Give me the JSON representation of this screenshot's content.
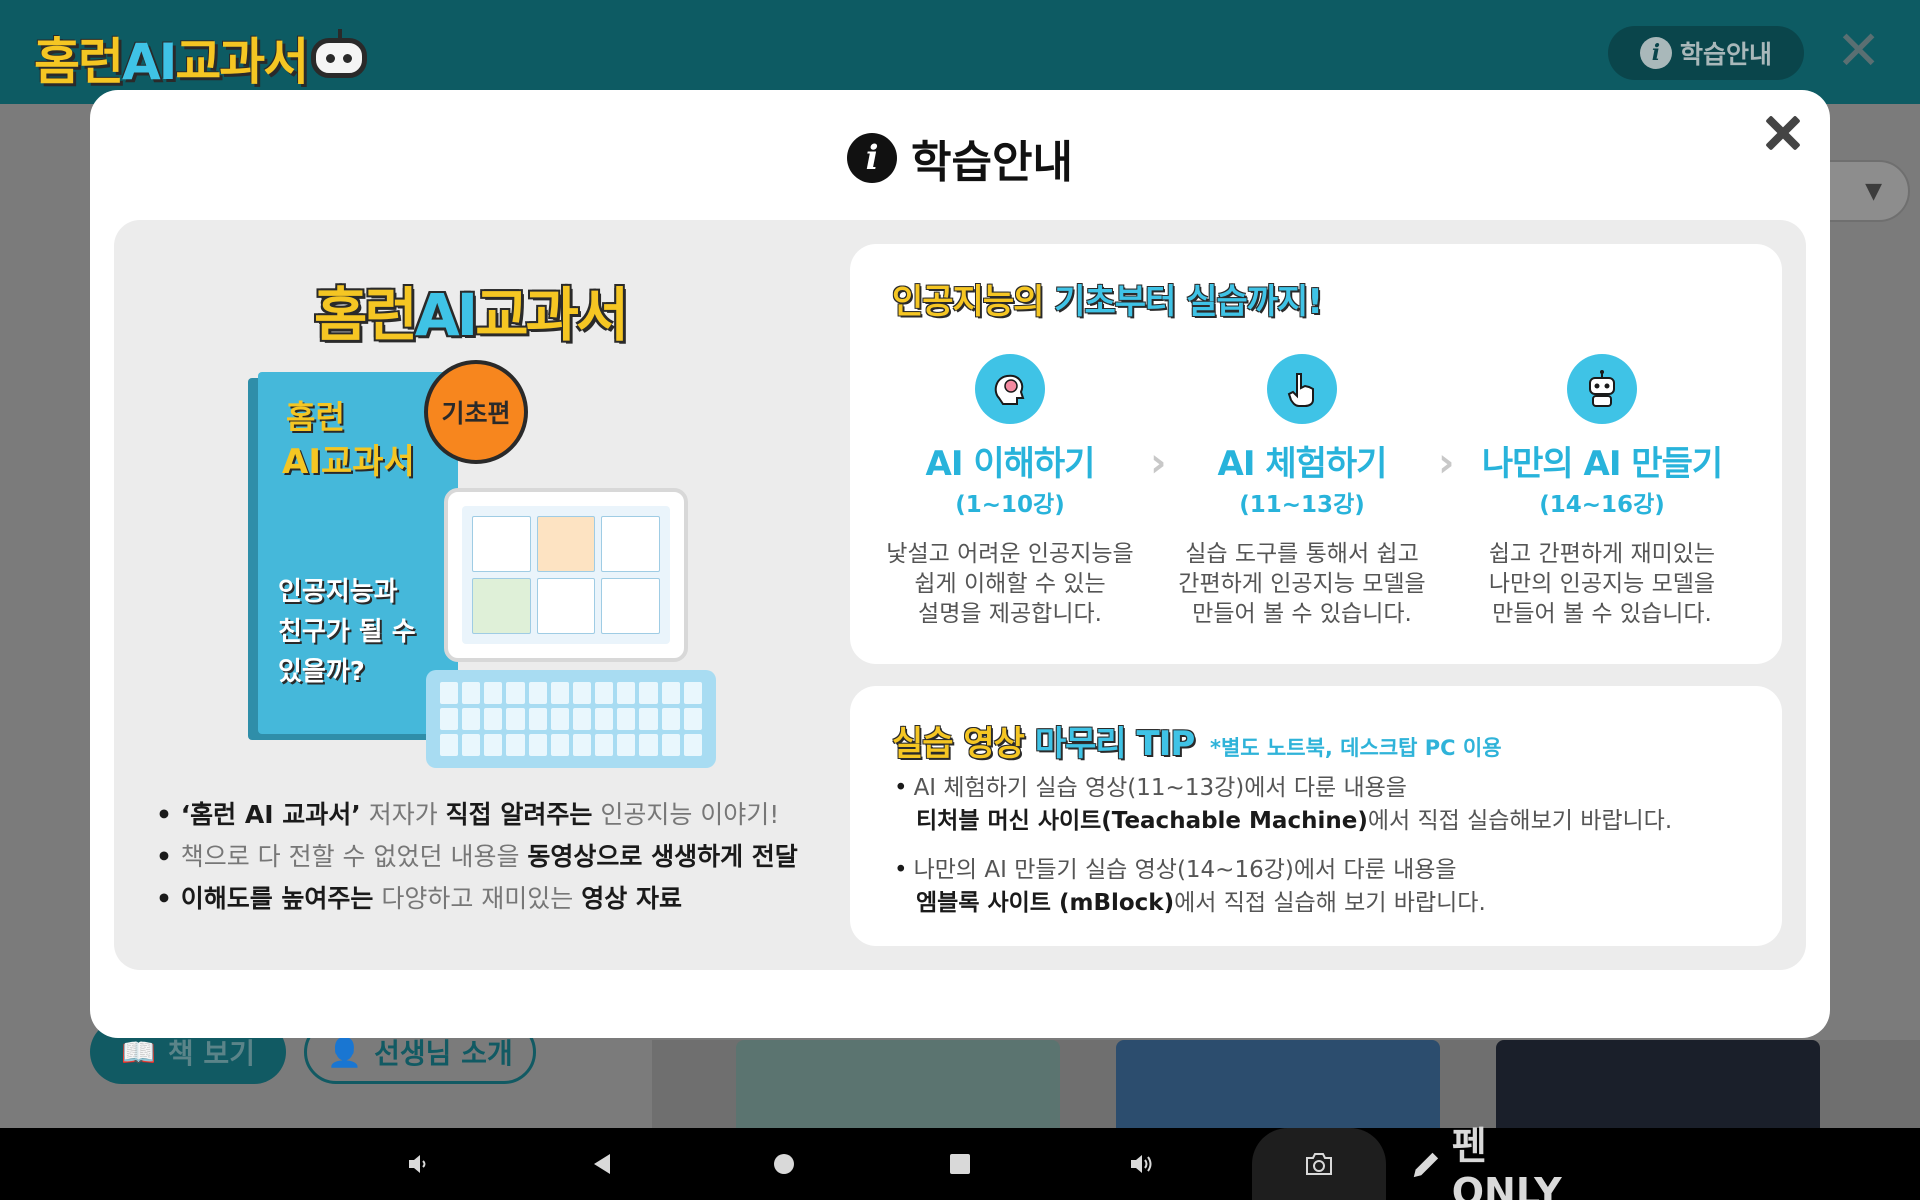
{
  "header": {
    "logo_part1": "홈런",
    "logo_ai": "AI",
    "logo_part2": "교과서",
    "info_button": "학습안내"
  },
  "background": {
    "button_book": "책 보기",
    "button_teacher": "선생님 소개"
  },
  "modal": {
    "title": "학습안내",
    "promo": {
      "logo_part1": "홈런",
      "logo_ai": "AI",
      "logo_part2": "교과서",
      "book_title1": "홈런",
      "book_title2": "AI교과서",
      "book_subtitle": "인공지능과 친구가 될 수 있을까?",
      "book_badge": "기초편",
      "bullets": [
        {
          "a": "‘홈런 AI 교과서’",
          "b": " 저자가 ",
          "c": "직접 알려주는",
          "d": " 인공지능 이야기!"
        },
        {
          "a": "책으로",
          "b": " 다 전할 수 없었던 내용을 ",
          "c": "동영상으로 생생하게 전달",
          "d": ""
        },
        {
          "a": "이해도를 높여주는",
          "b": " 다양하고 재미있는 ",
          "c": "영상 자료",
          "d": ""
        }
      ]
    },
    "steps_card": {
      "headline_1": "인공지능의",
      "headline_2": "기초부터",
      "headline_3": "실습까지!",
      "steps": [
        {
          "title": "AI 이해하기",
          "range": "(1~10강)",
          "desc_1": "낯설고 어려운 인공지능을",
          "desc_2": "쉽게 이해할 수 있는",
          "desc_3": "설명을 제공합니다."
        },
        {
          "title": "AI 체험하기",
          "range": "(11~13강)",
          "desc_1": "실습 도구를 통해서 쉽고",
          "desc_2": "간편하게 인공지능 모델을",
          "desc_3": "만들어 볼 수 있습니다."
        },
        {
          "title": "나만의 AI 만들기",
          "range": "(14~16강)",
          "desc_1": "쉽고 간편하게 재미있는",
          "desc_2": "나만의 인공지능 모델을",
          "desc_3": "만들어 볼 수 있습니다."
        }
      ]
    },
    "tips_card": {
      "headline_1": "실습",
      "headline_2": "영상",
      "headline_3": "마무리",
      "headline_4": "TIP",
      "note": "*별도 노트북, 데스크탑 PC 이용",
      "tips": [
        {
          "line1": "AI  체험하기 실습 영상(11~13강)에서 다룬 내용을",
          "strong": "티처블 머신 사이트(Teachable Machine)",
          "rest": "에서 직접 실습해보기 바랍니다."
        },
        {
          "line1": "나만의 AI 만들기 실습 영상(14~16강)에서 다룬 내용을",
          "strong": "엠블록 사이트 (mBlock)",
          "rest": "에서 직접 실습해 보기 바랍니다."
        }
      ]
    }
  },
  "navbar": {
    "pen_label": "펜 ONLY"
  },
  "colors": {
    "header": "#0d5b63",
    "accent_cyan": "#3fc3e6",
    "accent_yellow": "#f5c623",
    "badge_orange": "#f7861e"
  }
}
